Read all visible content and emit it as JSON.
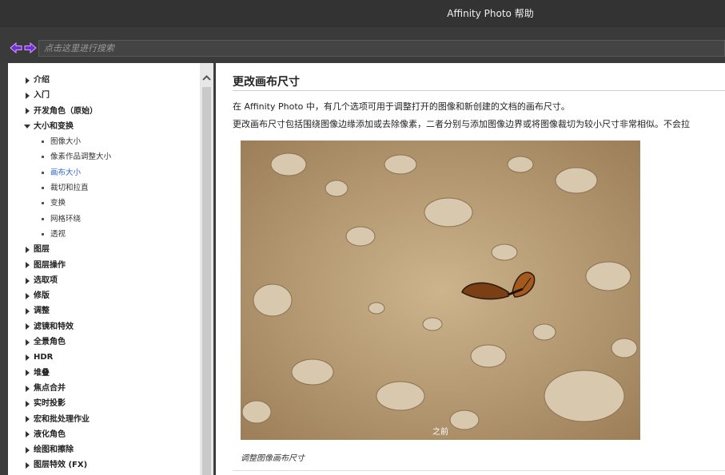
{
  "window": {
    "title": "Affinity Photo 帮助"
  },
  "toolbar": {
    "search_placeholder": "点击这里进行搜索",
    "back_icon": "back-arrow-icon",
    "forward_icon": "forward-arrow-icon",
    "accent": "#7a2bd6"
  },
  "sidebar": {
    "items": [
      {
        "label": "介绍",
        "expanded": false
      },
      {
        "label": "入门",
        "expanded": false
      },
      {
        "label": "开发角色（原始）",
        "expanded": false
      },
      {
        "label": "大小和变换",
        "expanded": true
      },
      {
        "label": "图层",
        "expanded": false
      },
      {
        "label": "图层操作",
        "expanded": false
      },
      {
        "label": "选取项",
        "expanded": false
      },
      {
        "label": "修版",
        "expanded": false
      },
      {
        "label": "调整",
        "expanded": false
      },
      {
        "label": "滤镜和特效",
        "expanded": false
      },
      {
        "label": "全景角色",
        "expanded": false
      },
      {
        "label": "HDR",
        "expanded": false
      },
      {
        "label": "堆叠",
        "expanded": false
      },
      {
        "label": "焦点合并",
        "expanded": false
      },
      {
        "label": "实时投影",
        "expanded": false
      },
      {
        "label": "宏和批处理作业",
        "expanded": false
      },
      {
        "label": "液化角色",
        "expanded": false
      },
      {
        "label": "绘图和擦除",
        "expanded": false
      },
      {
        "label": "图层特效 (FX)",
        "expanded": false
      }
    ],
    "subitems": [
      {
        "label": "图像大小",
        "active": false
      },
      {
        "label": "像素作品调整大小",
        "active": false
      },
      {
        "label": "画布大小",
        "active": true
      },
      {
        "label": "裁切和拉直",
        "active": false
      },
      {
        "label": "变换",
        "active": false
      },
      {
        "label": "网格环绕",
        "active": false
      },
      {
        "label": "透视",
        "active": false
      }
    ],
    "active_color": "#3366cc"
  },
  "content": {
    "heading": "更改画布尺寸",
    "para1": "在 Affinity Photo 中，有几个选项可用于调整打开的图像和新创建的文档的画布尺寸。",
    "para2": "更改画布尺寸包括围绕图像边缘添加或去除像素，二者分别与添加图像边界或将图像裁切为较小尺寸非常相似。不会拉",
    "image_label": "之前",
    "caption": "调整图像画布尺寸"
  }
}
